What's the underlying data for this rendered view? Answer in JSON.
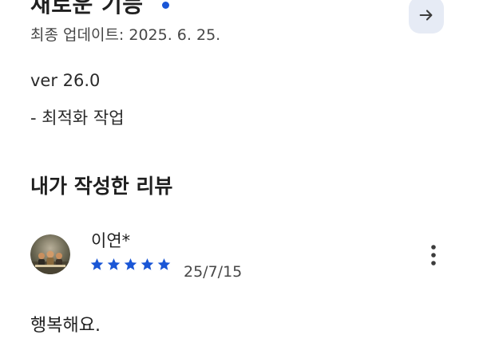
{
  "whats_new": {
    "title": "새로운 기능",
    "last_updated_label": "최종 업데이트:",
    "last_updated_date": "2025. 6. 25.",
    "version": "ver 26.0",
    "note": "- 최적화 작업",
    "arrow_icon": "arrow-right-icon",
    "dot_color": "#1a56d6"
  },
  "my_review": {
    "heading": "내가 작성한 리뷰",
    "reviewer_name": "이연*",
    "rating": 5,
    "rating_max": 5,
    "star_color": "#1a56d6",
    "date": "25/7/15",
    "body": "행복해요.",
    "more_icon": "more-vert-icon"
  }
}
